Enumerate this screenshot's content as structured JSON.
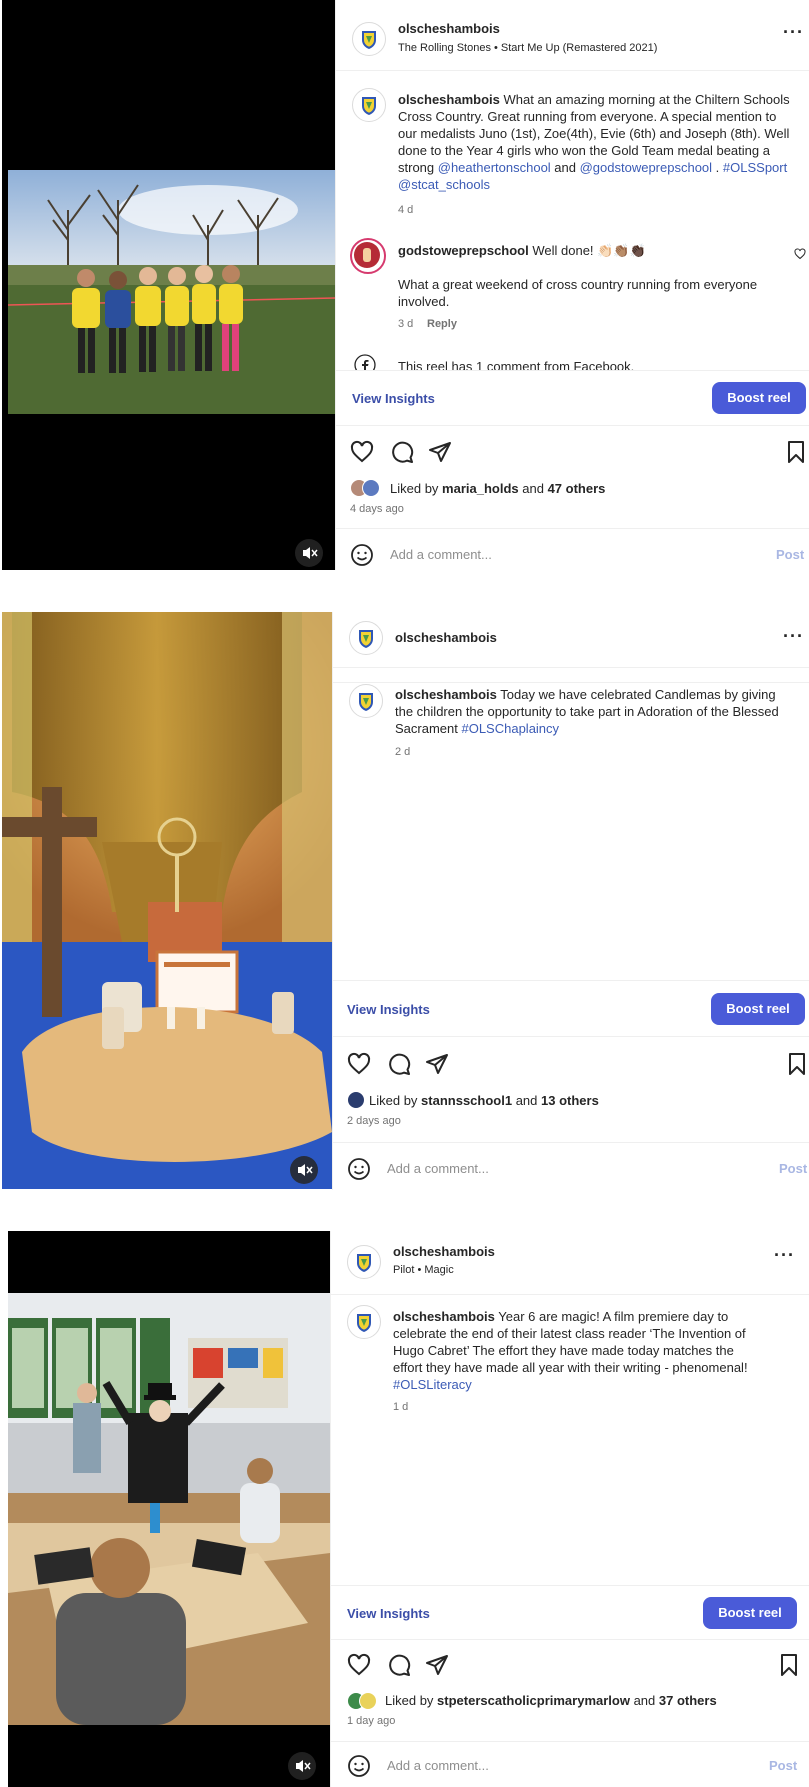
{
  "posts": [
    {
      "username": "olscheshambois",
      "subtitle": "The Rolling Stones • Start Me Up (Remastered 2021)",
      "caption_user": "olscheshambois",
      "caption_a": "What an amazing morning at the Chiltern Schools Cross Country. Great running from everyone. A special mention to our medalists Juno (1st), Zoe(4th), Evie (6th) and Joseph (8th). Well done to the Year 4 girls who won the Gold Team medal beating a strong ",
      "mention1": "@heathertonschool",
      "and_word": " and ",
      "mention2": "@godstoweprepschool",
      "caption_b": " . ",
      "tag1": "#OLSSport",
      "tag2": "@stcat_schools",
      "caption_age": "4 d",
      "comment_user": "godstoweprepschool",
      "comment_text": "Well done! 👏🏻👏🏽👏🏿",
      "comment_text2": "What a great weekend of cross country running from everyone involved.",
      "comment_age": "3 d",
      "reply": "Reply",
      "fb_note": "This reel has 1 comment from Facebook.",
      "insights": "View Insights",
      "boost": "Boost reel",
      "liked_prefix": "Liked by ",
      "liked_user": "maria_holds",
      "liked_and": " and ",
      "liked_others": "47 others",
      "post_age": "4 days ago",
      "comment_placeholder": "Add a comment...",
      "post_label": "Post"
    },
    {
      "username": "olscheshambois",
      "caption_user": "olscheshambois",
      "caption_a": "Today we have celebrated Candlemas by giving the children the opportunity to take part in Adoration of the Blessed Sacrament ",
      "tag1": "#OLSChaplaincy",
      "caption_age": "2 d",
      "insights": "View Insights",
      "boost": "Boost reel",
      "liked_prefix": "Liked by ",
      "liked_user": "stannsschool1",
      "liked_and": " and ",
      "liked_others": "13 others",
      "post_age": "2 days ago",
      "comment_placeholder": "Add a comment...",
      "post_label": "Post"
    },
    {
      "username": "olscheshambois",
      "subtitle": "Pilot • Magic",
      "caption_user": "olscheshambois",
      "caption_a": "Year 6 are magic! A film premiere day to celebrate the end of their latest class reader ‘The Invention of Hugo Cabret’ The effort they have made today matches the effort they have made all year with their writing - phenomenal! ",
      "tag1": "#OLSLiteracy",
      "caption_age": "1 d",
      "insights": "View Insights",
      "boost": "Boost reel",
      "liked_prefix": "Liked by ",
      "liked_user": "stpeterscatholicprimarymarlow",
      "liked_and": " and ",
      "liked_others": "37 others",
      "post_age": "1 day ago",
      "comment_placeholder": "Add a comment...",
      "post_label": "Post"
    }
  ],
  "icons": {
    "logo": "school-crest-icon",
    "more": "more-options-icon",
    "heart": "heart-icon",
    "comment": "comment-icon",
    "share": "share-icon",
    "save": "bookmark-icon",
    "mute": "muted-speaker-icon",
    "emoji": "emoji-icon",
    "facebook": "facebook-icon"
  },
  "colors": {
    "accent": "#4a5bd8",
    "link": "#3b5bb5",
    "crest_blue": "#2f57b5",
    "crest_yellow": "#f2d233"
  }
}
